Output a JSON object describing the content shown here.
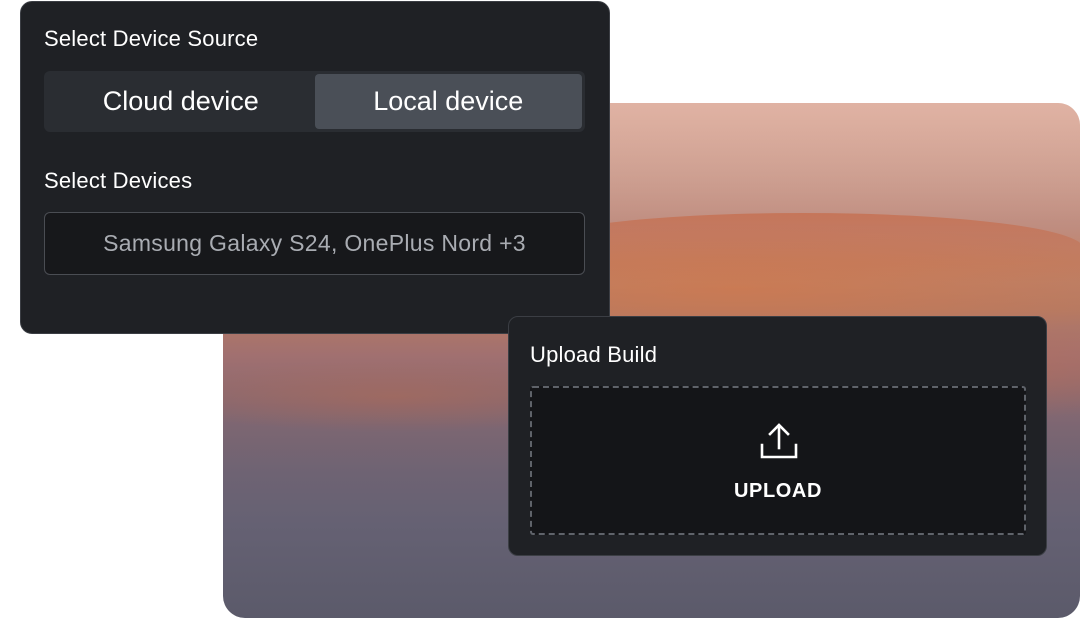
{
  "device_source": {
    "title": "Select Device Source",
    "options": [
      {
        "label": "Cloud device",
        "selected": false
      },
      {
        "label": "Local device",
        "selected": true
      }
    ]
  },
  "devices": {
    "title": "Select Devices",
    "value": "Samsung Galaxy S24, OnePlus Nord +3"
  },
  "upload": {
    "title": "Upload Build",
    "button_label": "UPLOAD",
    "icon": "upload-icon"
  },
  "colors": {
    "card_bg": "#1f2125",
    "active_segment": "#4a4f57",
    "text": "#ffffff",
    "muted_text": "#a9acb2"
  }
}
